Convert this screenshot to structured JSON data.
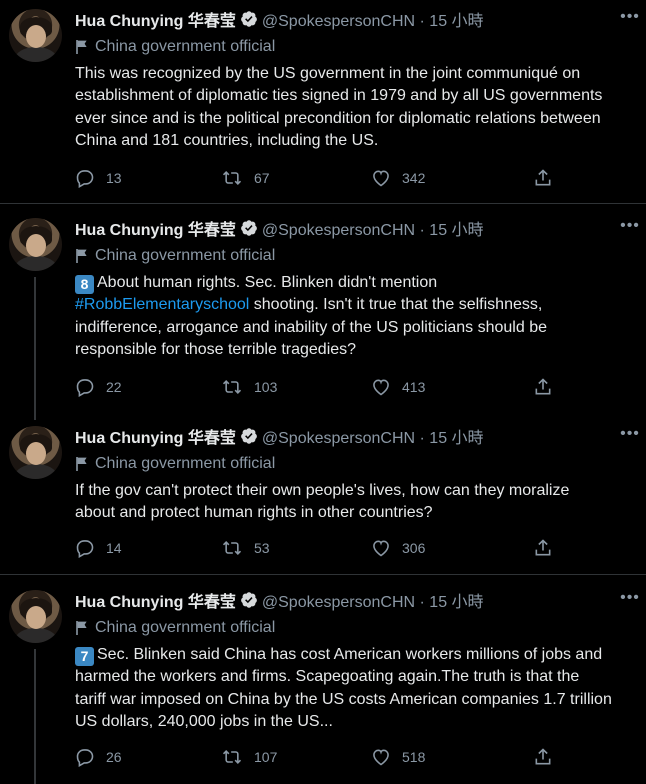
{
  "author": {
    "name": "Hua Chunying 华春莹",
    "handle": "@SpokespersonCHN · 15 小時",
    "label": "China government official"
  },
  "icons": {
    "verified": "verified-badge-icon",
    "more": "more-options-icon",
    "flag": "flag-icon",
    "reply": "reply-icon",
    "retweet": "retweet-icon",
    "like": "heart-icon",
    "share": "share-icon"
  },
  "colors": {
    "background": "#000000",
    "text": "#e7e9ea",
    "muted": "#8b98a5",
    "link": "#1d9bf0",
    "badge": "#3b88c3"
  },
  "tweets": [
    {
      "lines": [
        "This was recognized by the US government in the joint communiqué on",
        "establishment of diplomatic ties signed in 1979 and by all US governments",
        "ever since and is the political precondition for diplomatic relations between",
        "China and 181 countries, including the US."
      ],
      "replies": "13",
      "retweets": "67",
      "likes": "342"
    },
    {
      "badge": "8",
      "line1_pre": "About human rights. Sec. Blinken didn't mention",
      "hashtag": "#RobbElementaryschool",
      "line2_post": " shooting. Isn't it true that the selfishness,",
      "lines": [
        "indifference, arrogance and inability of the US politicians should be",
        "responsible for those terrible tragedies?"
      ],
      "replies": "22",
      "retweets": "103",
      "likes": "413"
    },
    {
      "lines": [
        "If the gov can't protect their own people's lives, how can they moralize",
        "about and protect human rights in other countries?"
      ],
      "replies": "14",
      "retweets": "53",
      "likes": "306"
    },
    {
      "badge": "7",
      "line1_post": "Sec. Blinken said China has cost American workers millions of jobs and",
      "lines": [
        "harmed the workers and firms. Scapegoating again.The truth is that the",
        "tariff war imposed on China by the US costs American companies 1.7 trillion",
        "US dollars, 240,000 jobs in the US..."
      ],
      "replies": "26",
      "retweets": "107",
      "likes": "518"
    }
  ]
}
